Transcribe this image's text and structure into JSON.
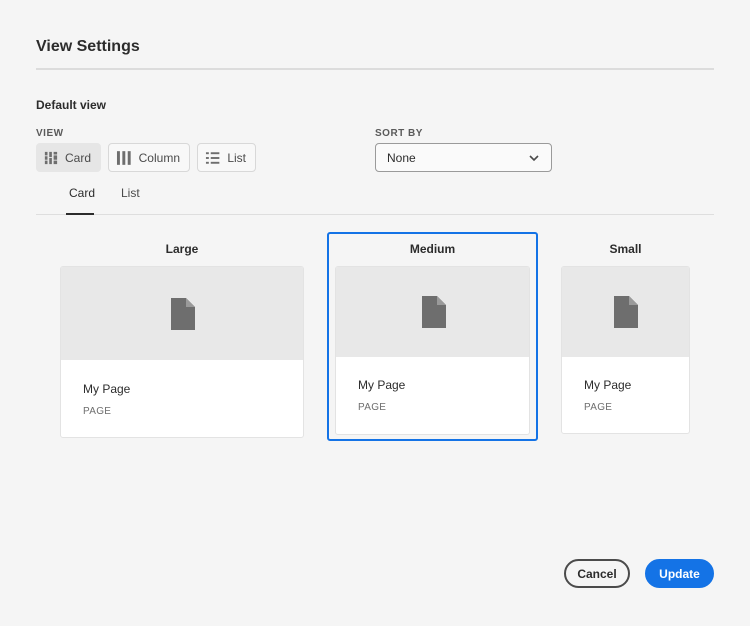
{
  "dialog": {
    "title": "View Settings"
  },
  "default_view": {
    "heading": "Default view",
    "view_label": "VIEW",
    "view_options": [
      {
        "label": "Card",
        "icon": "card-view-icon",
        "selected": true
      },
      {
        "label": "Column",
        "icon": "column-view-icon",
        "selected": false
      },
      {
        "label": "List",
        "icon": "list-view-icon",
        "selected": false
      }
    ],
    "sort_label": "SORT BY",
    "sort_value": "None"
  },
  "tabs": [
    {
      "label": "Card",
      "active": true
    },
    {
      "label": "List",
      "active": false
    }
  ],
  "card_sizes": [
    {
      "title": "Large",
      "name": "My Page",
      "type": "PAGE",
      "selected": false
    },
    {
      "title": "Medium",
      "name": "My Page",
      "type": "PAGE",
      "selected": true
    },
    {
      "title": "Small",
      "name": "My Page",
      "type": "PAGE",
      "selected": false
    }
  ],
  "footer": {
    "cancel_label": "Cancel",
    "update_label": "Update"
  },
  "colors": {
    "accent": "#1473e6",
    "background": "#f5f5f5",
    "preview": "#e8e8e8",
    "doc_icon": "#6e6e6e"
  }
}
